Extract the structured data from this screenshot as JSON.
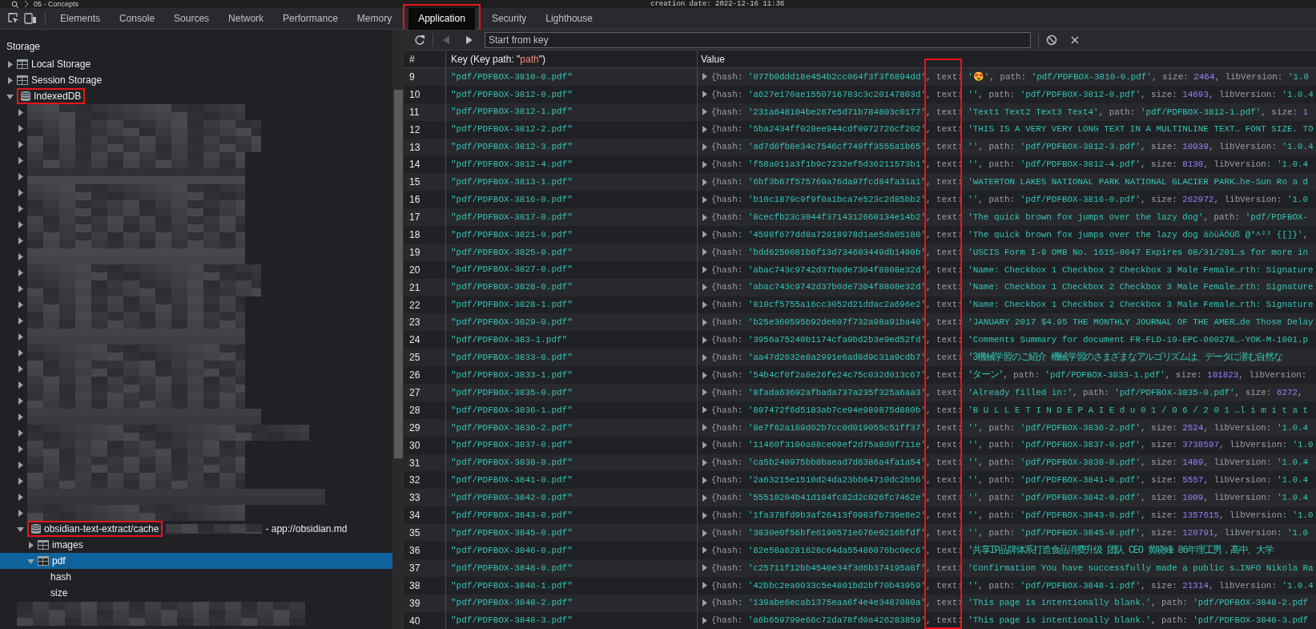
{
  "top_strip": {
    "breadcrumb": "05 - Concepts",
    "note": "creation date: 2022-12-16 11:36"
  },
  "devtools_tabs": [
    {
      "label": "Elements",
      "selected": false,
      "highlighted": false
    },
    {
      "label": "Console",
      "selected": false,
      "highlighted": false
    },
    {
      "label": "Sources",
      "selected": false,
      "highlighted": false
    },
    {
      "label": "Network",
      "selected": false,
      "highlighted": false
    },
    {
      "label": "Performance",
      "selected": false,
      "highlighted": false
    },
    {
      "label": "Memory",
      "selected": false,
      "highlighted": false
    },
    {
      "label": "Application",
      "selected": true,
      "highlighted": true
    },
    {
      "label": "Security",
      "selected": false,
      "highlighted": false
    },
    {
      "label": "Lighthouse",
      "selected": false,
      "highlighted": false
    }
  ],
  "sidebar": {
    "heading": "Storage",
    "items": [
      {
        "label": "Local Storage",
        "kind": "table",
        "expanded": false,
        "selected": false,
        "highlighted": false
      },
      {
        "label": "Session Storage",
        "kind": "table",
        "expanded": false,
        "selected": false,
        "highlighted": false
      },
      {
        "label": "IndexedDB",
        "kind": "database",
        "expanded": true,
        "selected": false,
        "highlighted": true,
        "children": [
          {
            "expanded": false,
            "selected": false,
            "redacted": true
          },
          {
            "expanded": false,
            "selected": false,
            "redacted": true
          },
          {
            "expanded": false,
            "selected": false,
            "redacted": true
          },
          {
            "expanded": false,
            "selected": false,
            "redacted": true
          },
          {
            "expanded": false,
            "selected": false,
            "redacted": true
          },
          {
            "expanded": false,
            "selected": false,
            "redacted": true
          },
          {
            "expanded": false,
            "selected": false,
            "redacted": true
          },
          {
            "expanded": false,
            "selected": false,
            "redacted": true
          },
          {
            "expanded": false,
            "selected": false,
            "redacted": true
          },
          {
            "expanded": false,
            "selected": false,
            "redacted": true
          },
          {
            "expanded": false,
            "selected": false,
            "redacted": true
          },
          {
            "expanded": false,
            "selected": false,
            "redacted": true
          },
          {
            "expanded": false,
            "selected": false,
            "redacted": true
          },
          {
            "expanded": false,
            "selected": false,
            "redacted": true
          },
          {
            "expanded": false,
            "selected": false,
            "redacted": true
          },
          {
            "expanded": false,
            "selected": false,
            "redacted": true
          },
          {
            "expanded": false,
            "selected": false,
            "redacted": true
          },
          {
            "expanded": false,
            "selected": false,
            "redacted": true
          },
          {
            "expanded": false,
            "selected": false,
            "redacted": true
          },
          {
            "expanded": false,
            "selected": false,
            "redacted": true
          },
          {
            "expanded": false,
            "selected": false,
            "redacted": true
          },
          {
            "expanded": false,
            "selected": false,
            "redacted": true
          },
          {
            "expanded": false,
            "selected": false,
            "redacted": true
          },
          {
            "expanded": false,
            "selected": false,
            "redacted": true
          },
          {
            "expanded": false,
            "selected": false,
            "redacted": true
          },
          {
            "expanded": false,
            "selected": false,
            "redacted": true
          },
          {
            "label": "obsidian-text-extract/cache",
            "origin": "- app://obsidian.md",
            "kind": "database",
            "expanded": true,
            "selected": false,
            "highlighted": true,
            "redacted": true,
            "children": [
              {
                "label": "images",
                "kind": "table",
                "expanded": false,
                "selected": false,
                "highlighted": false
              },
              {
                "label": "pdf",
                "kind": "table",
                "expanded": true,
                "selected": true,
                "highlighted": false,
                "children": [
                  {
                    "label": "hash",
                    "selected": false,
                    "highlighted": false
                  },
                  {
                    "label": "size",
                    "selected": false,
                    "highlighted": false
                  }
                ]
              }
            ]
          },
          {
            "selected": false,
            "redacted": true
          }
        ]
      }
    ]
  },
  "toolbar": {
    "nav_buttons": [
      {
        "kind": "refresh",
        "disabled": false
      },
      {
        "kind": "back",
        "disabled": true
      },
      {
        "kind": "forward",
        "disabled": false
      }
    ],
    "key_field": {
      "placeholder": "Start from key"
    },
    "action_buttons": [
      {
        "kind": "clear",
        "disabled": false
      },
      {
        "kind": "close",
        "disabled": false
      }
    ]
  },
  "table": {
    "columns": [
      {
        "parts": [
          {
            "kind": "label",
            "text": "#"
          }
        ]
      },
      {
        "parts": [
          {
            "kind": "label",
            "text": "Key (Key path: \""
          },
          {
            "kind": "keypath",
            "text": "path"
          },
          {
            "kind": "label",
            "text": "\")"
          }
        ]
      },
      {
        "parts": [
          {
            "kind": "label",
            "text": "Value"
          }
        ]
      }
    ],
    "text_column_highlighted": true,
    "rows": [
      {
        "index": "9",
        "key": "\"pdf/PDFBOX-3810-0.pdf\"",
        "expanded": false,
        "value": [
          {
            "kind": "key",
            "text": "{hash: "
          },
          {
            "kind": "string",
            "text": "'077b0ddd18e454b2cc064f3f3f6894dd'"
          },
          {
            "kind": "key",
            "text": ", text: "
          },
          {
            "kind": "string",
            "text": "'😍'"
          },
          {
            "kind": "key",
            "text": ", path: "
          },
          {
            "kind": "string",
            "text": "'pdf/PDFBOX-3810-0.pdf'"
          },
          {
            "kind": "key",
            "text": ", size: "
          },
          {
            "kind": "number",
            "text": "2464"
          },
          {
            "kind": "key",
            "text": ", libVersion: "
          },
          {
            "kind": "string",
            "text": "'1.0"
          }
        ]
      },
      {
        "index": "10",
        "key": "\"pdf/PDFBOX-3812-0.pdf\"",
        "expanded": false,
        "value": [
          {
            "kind": "key",
            "text": "{hash: "
          },
          {
            "kind": "string",
            "text": "'a627e170ae1550716783c3c20147803d'"
          },
          {
            "kind": "key",
            "text": ", text: "
          },
          {
            "kind": "string",
            "text": "''"
          },
          {
            "kind": "key",
            "text": ", path: "
          },
          {
            "kind": "string",
            "text": "'pdf/PDFBOX-3812-0.pdf'"
          },
          {
            "kind": "key",
            "text": ", size: "
          },
          {
            "kind": "number",
            "text": "14693"
          },
          {
            "kind": "key",
            "text": ", libVersion: "
          },
          {
            "kind": "string",
            "text": "'1.0.4"
          }
        ]
      },
      {
        "index": "11",
        "key": "\"pdf/PDFBOX-3812-1.pdf\"",
        "expanded": false,
        "value": [
          {
            "kind": "key",
            "text": "{hash: "
          },
          {
            "kind": "string",
            "text": "'231a648104be267e5d71b784803c0177'"
          },
          {
            "kind": "key",
            "text": ", text: "
          },
          {
            "kind": "string",
            "text": "'Text1 Text2 Text3 Text4'"
          },
          {
            "kind": "key",
            "text": ", path: "
          },
          {
            "kind": "string",
            "text": "'pdf/PDFBOX-3812-1.pdf'"
          },
          {
            "kind": "key",
            "text": ", size: "
          },
          {
            "kind": "number",
            "text": "1"
          }
        ]
      },
      {
        "index": "12",
        "key": "\"pdf/PDFBOX-3812-2.pdf\"",
        "expanded": false,
        "value": [
          {
            "kind": "key",
            "text": "{hash: "
          },
          {
            "kind": "string",
            "text": "'5ba2434ff028ee944cdf0972726cf202'"
          },
          {
            "kind": "key",
            "text": ", text: "
          },
          {
            "kind": "string",
            "text": "'THIS IS A VERY VERY LONG TEXT IN A MULTINLINE TEXT… FONT SIZE. TO"
          }
        ]
      },
      {
        "index": "13",
        "key": "\"pdf/PDFBOX-3812-3.pdf\"",
        "expanded": false,
        "value": [
          {
            "kind": "key",
            "text": "{hash: "
          },
          {
            "kind": "string",
            "text": "'ad7d6fb8e34c7546cf749ff3555a1b65'"
          },
          {
            "kind": "key",
            "text": ", text: "
          },
          {
            "kind": "string",
            "text": "''"
          },
          {
            "kind": "key",
            "text": ", path: "
          },
          {
            "kind": "string",
            "text": "'pdf/PDFBOX-3812-3.pdf'"
          },
          {
            "kind": "key",
            "text": ", size: "
          },
          {
            "kind": "number",
            "text": "10939"
          },
          {
            "kind": "key",
            "text": ", libVersion: "
          },
          {
            "kind": "string",
            "text": "'1.0.4"
          }
        ]
      },
      {
        "index": "14",
        "key": "\"pdf/PDFBOX-3812-4.pdf\"",
        "expanded": false,
        "value": [
          {
            "kind": "key",
            "text": "{hash: "
          },
          {
            "kind": "string",
            "text": "'f58a011a3f1b9c7232ef5d36211573b1'"
          },
          {
            "kind": "key",
            "text": ", text: "
          },
          {
            "kind": "string",
            "text": "''"
          },
          {
            "kind": "key",
            "text": ", path: "
          },
          {
            "kind": "string",
            "text": "'pdf/PDFBOX-3812-4.pdf'"
          },
          {
            "kind": "key",
            "text": ", size: "
          },
          {
            "kind": "number",
            "text": "8130"
          },
          {
            "kind": "key",
            "text": ", libVersion: "
          },
          {
            "kind": "string",
            "text": "'1.0.4"
          }
        ]
      },
      {
        "index": "15",
        "key": "\"pdf/PDFBOX-3813-1.pdf\"",
        "expanded": false,
        "value": [
          {
            "kind": "key",
            "text": "{hash: "
          },
          {
            "kind": "string",
            "text": "'6bf3b67f575769a76da97fcd84fa31a1'"
          },
          {
            "kind": "key",
            "text": ", text: "
          },
          {
            "kind": "string",
            "text": "'WATERTON LAKES NATIONAL PARK NATIONAL GLACIER PARK…he-Sun Ro a d"
          }
        ]
      },
      {
        "index": "16",
        "key": "\"pdf/PDFBOX-3816-0.pdf\"",
        "expanded": false,
        "value": [
          {
            "kind": "key",
            "text": "{hash: "
          },
          {
            "kind": "string",
            "text": "'b10c1879c9f9f0a1bca7e523c2d85bb2'"
          },
          {
            "kind": "key",
            "text": ", text: "
          },
          {
            "kind": "string",
            "text": "''"
          },
          {
            "kind": "key",
            "text": ", path: "
          },
          {
            "kind": "string",
            "text": "'pdf/PDFBOX-3816-0.pdf'"
          },
          {
            "kind": "key",
            "text": ", size: "
          },
          {
            "kind": "number",
            "text": "262972"
          },
          {
            "kind": "key",
            "text": ", libVersion: "
          },
          {
            "kind": "string",
            "text": "'1.0"
          }
        ]
      },
      {
        "index": "17",
        "key": "\"pdf/PDFBOX-3817-0.pdf\"",
        "expanded": false,
        "value": [
          {
            "kind": "key",
            "text": "{hash: "
          },
          {
            "kind": "string",
            "text": "'8cecfb23c3044f3714312660134e14b2'"
          },
          {
            "kind": "key",
            "text": ", text: "
          },
          {
            "kind": "string",
            "text": "'The quick brown fox jumps over the lazy dog'"
          },
          {
            "kind": "key",
            "text": ", path: "
          },
          {
            "kind": "string",
            "text": "'pdf/PDFBOX-"
          }
        ]
      },
      {
        "index": "18",
        "key": "\"pdf/PDFBOX-3821-0.pdf\"",
        "expanded": false,
        "value": [
          {
            "kind": "key",
            "text": "{hash: "
          },
          {
            "kind": "string",
            "text": "'4598f677dd8a72918978d1ae5da05180'"
          },
          {
            "kind": "key",
            "text": ", text: "
          },
          {
            "kind": "string",
            "text": "'The quick brown fox jumps over the lazy dog äöüÄÖÜß @°^²³ {[]}'"
          },
          {
            "kind": "key",
            "text": ","
          }
        ]
      },
      {
        "index": "19",
        "key": "\"pdf/PDFBOX-3825-0.pdf\"",
        "expanded": false,
        "value": [
          {
            "kind": "key",
            "text": "{hash: "
          },
          {
            "kind": "string",
            "text": "'bdd6250681b6f13d734603449db1490b'"
          },
          {
            "kind": "key",
            "text": ", text: "
          },
          {
            "kind": "string",
            "text": "'USCIS Form I-9 OMB No. 1615-0047 Expires 08/31/201…s for more in"
          }
        ]
      },
      {
        "index": "20",
        "key": "\"pdf/PDFBOX-3827-0.pdf\"",
        "expanded": false,
        "value": [
          {
            "kind": "key",
            "text": "{hash: "
          },
          {
            "kind": "string",
            "text": "'abac743c9742d37b0de7304f8808e32d'"
          },
          {
            "kind": "key",
            "text": ", text: "
          },
          {
            "kind": "string",
            "text": "'Name: Checkbox 1 Checkbox 2 Checkbox 3 Male Female…rth: Signature"
          }
        ]
      },
      {
        "index": "21",
        "key": "\"pdf/PDFBOX-3828-0.pdf\"",
        "expanded": false,
        "value": [
          {
            "kind": "key",
            "text": "{hash: "
          },
          {
            "kind": "string",
            "text": "'abac743c9742d37b0de7304f8808e32d'"
          },
          {
            "kind": "key",
            "text": ", text: "
          },
          {
            "kind": "string",
            "text": "'Name: Checkbox 1 Checkbox 2 Checkbox 3 Male Female…rth: Signature"
          }
        ]
      },
      {
        "index": "22",
        "key": "\"pdf/PDFBOX-3828-1.pdf\"",
        "expanded": false,
        "value": [
          {
            "kind": "key",
            "text": "{hash: "
          },
          {
            "kind": "string",
            "text": "'810cf5755a16cc3052d21ddac2a696e2'"
          },
          {
            "kind": "key",
            "text": ", text: "
          },
          {
            "kind": "string",
            "text": "'Name: Checkbox 1 Checkbox 2 Checkbox 3 Male Female…rth: Signature"
          }
        ]
      },
      {
        "index": "23",
        "key": "\"pdf/PDFBOX-3829-0.pdf\"",
        "expanded": false,
        "value": [
          {
            "kind": "key",
            "text": "{hash: "
          },
          {
            "kind": "string",
            "text": "'b25e360595b92de607f732a98a91ba40'"
          },
          {
            "kind": "key",
            "text": ", text: "
          },
          {
            "kind": "string",
            "text": "'JANUARY 2017 $4.95 THE MONTHLY JOURNAL OF THE AMER…de Those Delay"
          }
        ]
      },
      {
        "index": "24",
        "key": "\"pdf/PDFBOX-383-1.pdf\"",
        "expanded": false,
        "value": [
          {
            "kind": "key",
            "text": "{hash: "
          },
          {
            "kind": "string",
            "text": "'3956a75240b1174cfa0bd2b3e9ed52fd'"
          },
          {
            "kind": "key",
            "text": ", text: "
          },
          {
            "kind": "string",
            "text": "'Comments Summary for document FR-FLD-10-EPC-000278…-YOK-M-1001.p"
          }
        ]
      },
      {
        "index": "25",
        "key": "\"pdf/PDFBOX-3833-0.pdf\"",
        "expanded": false,
        "value": [
          {
            "kind": "key",
            "text": "{hash: "
          },
          {
            "kind": "string",
            "text": "'aa47d2632e8a2991e6ad8d9c31a9cdb7'"
          },
          {
            "kind": "key",
            "text": ", text: "
          },
          {
            "kind": "string",
            "text": "'3機械学習のご紹介 機械学習のさまざまなアルゴリズムは、データに潜む自然な"
          }
        ]
      },
      {
        "index": "26",
        "key": "\"pdf/PDFBOX-3833-1.pdf\"",
        "expanded": false,
        "value": [
          {
            "kind": "key",
            "text": "{hash: "
          },
          {
            "kind": "string",
            "text": "'54b4cf0f2a8e26fe24c75c032d013c67'"
          },
          {
            "kind": "key",
            "text": ", text: "
          },
          {
            "kind": "string",
            "text": "'ターン'"
          },
          {
            "kind": "key",
            "text": ", path: "
          },
          {
            "kind": "string",
            "text": "'pdf/PDFBOX-3833-1.pdf'"
          },
          {
            "kind": "key",
            "text": ", size: "
          },
          {
            "kind": "number",
            "text": "101823"
          },
          {
            "kind": "key",
            "text": ", libVersion:"
          }
        ]
      },
      {
        "index": "27",
        "key": "\"pdf/PDFBOX-3835-0.pdf\"",
        "expanded": false,
        "value": [
          {
            "kind": "key",
            "text": "{hash: "
          },
          {
            "kind": "string",
            "text": "'8fada63692afbada737a235f325a6aa3'"
          },
          {
            "kind": "key",
            "text": ", text: "
          },
          {
            "kind": "string",
            "text": "'Already filled in:'"
          },
          {
            "kind": "key",
            "text": ", path: "
          },
          {
            "kind": "string",
            "text": "'pdf/PDFBOX-3835-0.pdf'"
          },
          {
            "kind": "key",
            "text": ", size: "
          },
          {
            "kind": "number",
            "text": "6272"
          },
          {
            "kind": "key",
            "text": ","
          }
        ]
      },
      {
        "index": "28",
        "key": "\"pdf/PDFBOX-3836-1.pdf\"",
        "expanded": false,
        "value": [
          {
            "kind": "key",
            "text": "{hash: "
          },
          {
            "kind": "string",
            "text": "'807472f6d5183ab7ce94e989875d880b'"
          },
          {
            "kind": "key",
            "text": ", text: "
          },
          {
            "kind": "string",
            "text": "'B U L L E T I N D E P A I E d u 0 1 / 0 6 / 2 0 1 …l i m i t a t"
          }
        ]
      },
      {
        "index": "29",
        "key": "\"pdf/PDFBOX-3836-2.pdf\"",
        "expanded": false,
        "value": [
          {
            "kind": "key",
            "text": "{hash: "
          },
          {
            "kind": "string",
            "text": "'8e7f62a189d02b7cc0d019055c51ff37'"
          },
          {
            "kind": "key",
            "text": ", text: "
          },
          {
            "kind": "string",
            "text": "''"
          },
          {
            "kind": "key",
            "text": ", path: "
          },
          {
            "kind": "string",
            "text": "'pdf/PDFBOX-3836-2.pdf'"
          },
          {
            "kind": "key",
            "text": ", size: "
          },
          {
            "kind": "number",
            "text": "2524"
          },
          {
            "kind": "key",
            "text": ", libVersion: "
          },
          {
            "kind": "string",
            "text": "'1.0.4"
          }
        ]
      },
      {
        "index": "30",
        "key": "\"pdf/PDFBOX-3837-0.pdf\"",
        "expanded": false,
        "value": [
          {
            "kind": "key",
            "text": "{hash: "
          },
          {
            "kind": "string",
            "text": "'11460f3100a88ce09ef2d75a8d0f711e'"
          },
          {
            "kind": "key",
            "text": ", text: "
          },
          {
            "kind": "string",
            "text": "''"
          },
          {
            "kind": "key",
            "text": ", path: "
          },
          {
            "kind": "string",
            "text": "'pdf/PDFBOX-3837-0.pdf'"
          },
          {
            "kind": "key",
            "text": ", size: "
          },
          {
            "kind": "number",
            "text": "3738597"
          },
          {
            "kind": "key",
            "text": ", libVersion: "
          },
          {
            "kind": "string",
            "text": "'1.0"
          }
        ]
      },
      {
        "index": "31",
        "key": "\"pdf/PDFBOX-3838-0.pdf\"",
        "expanded": false,
        "value": [
          {
            "kind": "key",
            "text": "{hash: "
          },
          {
            "kind": "string",
            "text": "'ca5b240975bb8baead7d6386a4fa1a54'"
          },
          {
            "kind": "key",
            "text": ", text: "
          },
          {
            "kind": "string",
            "text": "''"
          },
          {
            "kind": "key",
            "text": ", path: "
          },
          {
            "kind": "string",
            "text": "'pdf/PDFBOX-3838-0.pdf'"
          },
          {
            "kind": "key",
            "text": ", size: "
          },
          {
            "kind": "number",
            "text": "1489"
          },
          {
            "kind": "key",
            "text": ", libVersion: "
          },
          {
            "kind": "string",
            "text": "'1.0.4"
          }
        ]
      },
      {
        "index": "32",
        "key": "\"pdf/PDFBOX-3841-0.pdf\"",
        "expanded": false,
        "value": [
          {
            "kind": "key",
            "text": "{hash: "
          },
          {
            "kind": "string",
            "text": "'2a63215e1510d24da23bb64710dc2b56'"
          },
          {
            "kind": "key",
            "text": ", text: "
          },
          {
            "kind": "string",
            "text": "''"
          },
          {
            "kind": "key",
            "text": ", path: "
          },
          {
            "kind": "string",
            "text": "'pdf/PDFBOX-3841-0.pdf'"
          },
          {
            "kind": "key",
            "text": ", size: "
          },
          {
            "kind": "number",
            "text": "5557"
          },
          {
            "kind": "key",
            "text": ", libVersion: "
          },
          {
            "kind": "string",
            "text": "'1.0.4"
          }
        ]
      },
      {
        "index": "33",
        "key": "\"pdf/PDFBOX-3842-0.pdf\"",
        "expanded": false,
        "value": [
          {
            "kind": "key",
            "text": "{hash: "
          },
          {
            "kind": "string",
            "text": "'55510204b41d104fc82d2c026fc7462e'"
          },
          {
            "kind": "key",
            "text": ", text: "
          },
          {
            "kind": "string",
            "text": "''"
          },
          {
            "kind": "key",
            "text": ", path: "
          },
          {
            "kind": "string",
            "text": "'pdf/PDFBOX-3842-0.pdf'"
          },
          {
            "kind": "key",
            "text": ", size: "
          },
          {
            "kind": "number",
            "text": "1009"
          },
          {
            "kind": "key",
            "text": ", libVersion: "
          },
          {
            "kind": "string",
            "text": "'1.0.4"
          }
        ]
      },
      {
        "index": "34",
        "key": "\"pdf/PDFBOX-3843-0.pdf\"",
        "expanded": false,
        "value": [
          {
            "kind": "key",
            "text": "{hash: "
          },
          {
            "kind": "string",
            "text": "'1fa378fd9b3af26413f0983fb739e8e2'"
          },
          {
            "kind": "key",
            "text": ", text: "
          },
          {
            "kind": "string",
            "text": "''"
          },
          {
            "kind": "key",
            "text": ", path: "
          },
          {
            "kind": "string",
            "text": "'pdf/PDFBOX-3843-0.pdf'"
          },
          {
            "kind": "key",
            "text": ", size: "
          },
          {
            "kind": "number",
            "text": "1357615"
          },
          {
            "kind": "key",
            "text": ", libVersion: "
          },
          {
            "kind": "string",
            "text": "'1.0"
          }
        ]
      },
      {
        "index": "35",
        "key": "\"pdf/PDFBOX-3845-0.pdf\"",
        "expanded": false,
        "value": [
          {
            "kind": "key",
            "text": "{hash: "
          },
          {
            "kind": "string",
            "text": "'3830e0f56bfe6190571e676e0216bfdf'"
          },
          {
            "kind": "key",
            "text": ", text: "
          },
          {
            "kind": "string",
            "text": "''"
          },
          {
            "kind": "key",
            "text": ", path: "
          },
          {
            "kind": "string",
            "text": "'pdf/PDFBOX-3845-0.pdf'"
          },
          {
            "kind": "key",
            "text": ", size: "
          },
          {
            "kind": "number",
            "text": "120791"
          },
          {
            "kind": "key",
            "text": ", libVersion: "
          },
          {
            "kind": "string",
            "text": "'1.0"
          }
        ]
      },
      {
        "index": "36",
        "key": "\"pdf/PDFBOX-3846-0.pdf\"",
        "expanded": false,
        "value": [
          {
            "kind": "key",
            "text": "{hash: "
          },
          {
            "kind": "string",
            "text": "'82e58a6281628c64da55486076bc0ec6'"
          },
          {
            "kind": "key",
            "text": ", text: "
          },
          {
            "kind": "string",
            "text": "'共享IP品牌体系打造食品消费升级 团队 CEO 黄晓峰 86年理工男，高中、大学"
          }
        ]
      },
      {
        "index": "37",
        "key": "\"pdf/PDFBOX-3848-0.pdf\"",
        "expanded": false,
        "value": [
          {
            "kind": "key",
            "text": "{hash: "
          },
          {
            "kind": "string",
            "text": "'c25711f12bb4540e34f3d6b374195a8f'"
          },
          {
            "kind": "key",
            "text": ", text: "
          },
          {
            "kind": "string",
            "text": "'Confirmation You have successfully made a public s…INFO Nikola Ra"
          }
        ]
      },
      {
        "index": "38",
        "key": "\"pdf/PDFBOX-3848-1.pdf\"",
        "expanded": false,
        "value": [
          {
            "kind": "key",
            "text": "{hash: "
          },
          {
            "kind": "string",
            "text": "'42bbc2ea0033c5e4801bd2bf70b43959'"
          },
          {
            "kind": "key",
            "text": ", text: "
          },
          {
            "kind": "string",
            "text": "''"
          },
          {
            "kind": "key",
            "text": ", path: "
          },
          {
            "kind": "string",
            "text": "'pdf/PDFBOX-3848-1.pdf'"
          },
          {
            "kind": "key",
            "text": ", size: "
          },
          {
            "kind": "number",
            "text": "21314"
          },
          {
            "kind": "key",
            "text": ", libVersion: "
          },
          {
            "kind": "string",
            "text": "'1.0.4"
          }
        ]
      },
      {
        "index": "39",
        "key": "\"pdf/PDFBOX-3848-2.pdf\"",
        "expanded": false,
        "value": [
          {
            "kind": "key",
            "text": "{hash: "
          },
          {
            "kind": "string",
            "text": "'139abe6ecab1375eaa6f4e4e3487080a'"
          },
          {
            "kind": "key",
            "text": ", text: "
          },
          {
            "kind": "string",
            "text": "'This page is intentionally blank.'"
          },
          {
            "kind": "key",
            "text": ", path: "
          },
          {
            "kind": "string",
            "text": "'pdf/PDFBOX-3848-2.pdf"
          }
        ]
      },
      {
        "index": "40",
        "key": "\"pdf/PDFBOX-3848-3.pdf\"",
        "expanded": false,
        "value": [
          {
            "kind": "key",
            "text": "{hash: "
          },
          {
            "kind": "string",
            "text": "'a6b659799e66c72da78fd0a426283859'"
          },
          {
            "kind": "key",
            "text": ", text: "
          },
          {
            "kind": "string",
            "text": "'This page is intentionally blank.'"
          },
          {
            "kind": "key",
            "text": ", path: "
          },
          {
            "kind": "string",
            "text": "'pdf/PDFBOX-3848-3.pdf"
          }
        ]
      }
    ]
  }
}
